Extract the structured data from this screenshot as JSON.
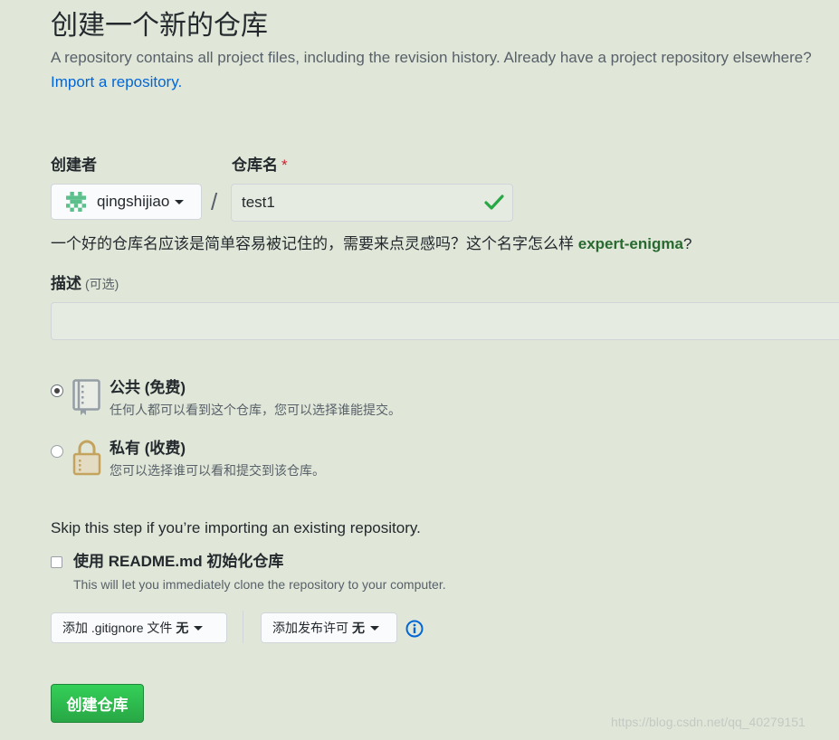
{
  "header": {
    "title": "创建一个新的仓库",
    "lead": "A repository contains all project files, including the revision history. Already have a project repository elsewhere?",
    "import_link": "Import a repository."
  },
  "owner": {
    "label": "创建者",
    "value": "qingshijiao",
    "icon": "identicon-avatar"
  },
  "repo_name": {
    "label": "仓库名",
    "required_mark": "*",
    "separator": "/",
    "value": "test1",
    "valid_icon": "check-icon"
  },
  "hint": {
    "text": "一个好的仓库名应该是简单容易被记住的，需要来点灵感吗？这个名字怎么样",
    "suggestion": "expert-enigma",
    "suffix": "?"
  },
  "description": {
    "label": "描述",
    "optional": "(可选)",
    "value": ""
  },
  "visibility": {
    "public": {
      "title": "公共 (免费)",
      "desc": "任何人都可以看到这个仓库，您可以选择谁能提交。",
      "checked": true,
      "icon": "repo-book-icon"
    },
    "private": {
      "title": "私有 (收费)",
      "desc": "您可以选择谁可以看和提交到该仓库。",
      "checked": false,
      "icon": "lock-icon"
    }
  },
  "init": {
    "skip_text": "Skip this step if you’re importing an existing repository.",
    "readme_title": "使用 README.md 初始化仓库",
    "readme_desc": "This will let you immediately clone the repository to your computer.",
    "readme_checked": false
  },
  "gitignore": {
    "label": "添加 .gitignore 文件",
    "value": "无"
  },
  "license": {
    "label": "添加发布许可",
    "value": "无"
  },
  "create_button": "创建仓库",
  "watermark": "https://blog.csdn.net/qq_40279151",
  "colors": {
    "background": "#e0e7d9",
    "link": "#0366d6",
    "success": "#28a745",
    "suggestion": "#28692f",
    "required": "#cb2431"
  }
}
